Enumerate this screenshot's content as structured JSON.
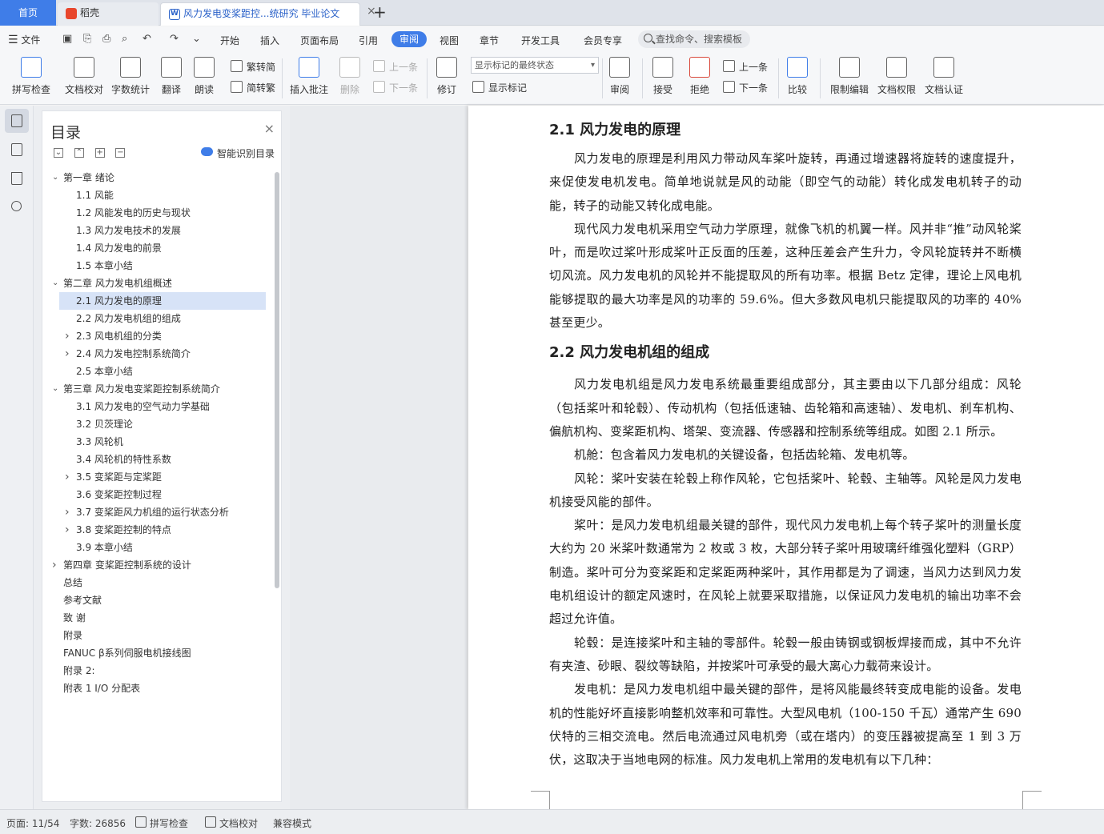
{
  "tabs": {
    "home": "首页",
    "daoke": "稻壳",
    "doc": "风力发电变桨距控...统研究 毕业论文",
    "close": "×",
    "add": "+"
  },
  "menu": {
    "file": "文件",
    "items": [
      "开始",
      "插入",
      "页面布局",
      "引用",
      "审阅",
      "视图",
      "章节",
      "开发工具",
      "会员专享"
    ],
    "active": "审阅",
    "search": "查找命令、搜索模板"
  },
  "ribbon": {
    "spell": "拼写检查",
    "proof": "文档校对",
    "count": "字数统计",
    "translate": "翻译",
    "read": "朗读",
    "trad": "繁转简",
    "simp": "简转繁",
    "insert_comment": "插入批注",
    "delete": "删除",
    "prev": "上一条",
    "next": "下一条",
    "revise": "修订",
    "markup_state": "显示标记的最终状态",
    "show_markup": "显示标记",
    "review": "审阅",
    "accept": "接受",
    "reject": "拒绝",
    "prev2": "上一条",
    "next2": "下一条",
    "compare": "比较",
    "restrict": "限制编辑",
    "rights": "文档权限",
    "certify": "文档认证"
  },
  "toc": {
    "title": "目录",
    "smart": "智能识别目录",
    "items": [
      {
        "label": "第一章  绪论",
        "level": 1,
        "arrow": "expanded"
      },
      {
        "label": "1.1 风能",
        "level": 2,
        "arrow": ""
      },
      {
        "label": "1.2 风能发电的历史与现状",
        "level": 2,
        "arrow": ""
      },
      {
        "label": "1.3 风力发电技术的发展",
        "level": 2,
        "arrow": ""
      },
      {
        "label": "1.4 风力发电的前景",
        "level": 2,
        "arrow": ""
      },
      {
        "label": "1.5  本章小结",
        "level": 2,
        "arrow": ""
      },
      {
        "label": "第二章  风力发电机组概述",
        "level": 1,
        "arrow": "expanded"
      },
      {
        "label": "2.1  风力发电的原理",
        "level": 2,
        "arrow": "",
        "active": true
      },
      {
        "label": "2.2  风力发电机组的组成",
        "level": 2,
        "arrow": ""
      },
      {
        "label": "2.3  风电机组的分类",
        "level": 2,
        "arrow": "collapsed"
      },
      {
        "label": "2.4  风力发电控制系统简介",
        "level": 2,
        "arrow": "collapsed"
      },
      {
        "label": "2.5  本章小结",
        "level": 2,
        "arrow": ""
      },
      {
        "label": "第三章  风力发电变桨距控制系统简介",
        "level": 1,
        "arrow": "expanded"
      },
      {
        "label": "3.1  风力发电的空气动力学基础",
        "level": 2,
        "arrow": ""
      },
      {
        "label": "3.2 贝茨理论",
        "level": 2,
        "arrow": ""
      },
      {
        "label": "3.3  风轮机",
        "level": 2,
        "arrow": ""
      },
      {
        "label": "3.4  风轮机的特性系数",
        "level": 2,
        "arrow": ""
      },
      {
        "label": "3.5 变桨距与定桨距",
        "level": 2,
        "arrow": "collapsed"
      },
      {
        "label": "3.6  变桨距控制过程",
        "level": 2,
        "arrow": ""
      },
      {
        "label": "3.7  变桨距风力机组的运行状态分析",
        "level": 2,
        "arrow": "collapsed"
      },
      {
        "label": "3.8  变桨距控制的特点",
        "level": 2,
        "arrow": "collapsed"
      },
      {
        "label": "3.9  本章小结",
        "level": 2,
        "arrow": ""
      },
      {
        "label": "第四章  变桨距控制系统的设计",
        "level": 1,
        "arrow": "collapsed"
      },
      {
        "label": "总结",
        "level": 1,
        "arrow": ""
      },
      {
        "label": "参考文献",
        "level": 1,
        "arrow": ""
      },
      {
        "label": "致    谢",
        "level": 1,
        "arrow": ""
      },
      {
        "label": "附录",
        "level": 1,
        "arrow": ""
      },
      {
        "label": "FANUC β系列伺服电机接线图",
        "level": 1,
        "arrow": ""
      },
      {
        "label": "附录 2:",
        "level": 1,
        "arrow": ""
      },
      {
        "label": "附表 1    I/O 分配表",
        "level": 1,
        "arrow": ""
      }
    ]
  },
  "doc": {
    "h1": "2.1  风力发电的原理",
    "p1": "风力发电的原理是利用风力带动风车桨叶旋转，再通过增速器将旋转的速度提升，来促使发电机发电。简单地说就是风的动能（即空气的动能）转化成发电机转子的动能，转子的动能又转化成电能。",
    "p2": "现代风力发电机采用空气动力学原理，就像飞机的机翼一样。风并非“推”动风轮桨叶，而是吹过桨叶形成桨叶正反面的压差，这种压差会产生升力，令风轮旋转并不断横切风流。风力发电机的风轮并不能提取风的所有功率。根据 Betz 定律，理论上风电机能够提取的最大功率是风的功率的 59.6%。但大多数风电机只能提取风的功率的 40%甚至更少。",
    "h2": "2.2  风力发电机组的组成",
    "p3": "风力发电机组是风力发电系统最重要组成部分，其主要由以下几部分组成：风轮（包括桨叶和轮毂）、传动机构（包括低速轴、齿轮箱和高速轴）、发电机、刹车机构、偏航机构、变桨距机构、塔架、变流器、传感器和控制系统等组成。如图 2.1 所示。",
    "p4": "机舱：包含着风力发电机的关键设备，包括齿轮箱、发电机等。",
    "p5": "风轮：桨叶安装在轮毂上称作风轮，它包括桨叶、轮毂、主轴等。风轮是风力发电机接受风能的部件。",
    "p6": "桨叶：是风力发电机组最关键的部件，现代风力发电机上每个转子桨叶的测量长度大约为 20 米桨叶数通常为 2 枚或 3 枚，大部分转子桨叶用玻璃纤维强化塑料（GRP）制造。桨叶可分为变桨距和定桨距两种桨叶，其作用都是为了调速，当风力达到风力发电机组设计的额定风速时，在风轮上就要采取措施，以保证风力发电机的输出功率不会超过允许值。",
    "p7": "轮毂：是连接桨叶和主轴的零部件。轮毂一般由铸钢或钢板焊接而成，其中不允许有夹渣、砂眼、裂纹等缺陷，并按桨叶可承受的最大离心力载荷来设计。",
    "p8": "发电机：是风力发电机组中最关键的部件，是将风能最终转变成电能的设备。发电机的性能好坏直接影响整机效率和可靠性。大型风电机（100-150 千瓦）通常产生 690 伏特的三相交流电。然后电流通过风电机旁（或在塔内）的变压器被提高至 1 到 3 万伏，这取决于当地电网的标准。风力发电机上常用的发电机有以下几种："
  },
  "status": {
    "page": "页面: 11/54",
    "words": "字数: 26856",
    "spell": "拼写检查",
    "proof": "文档校对",
    "compat": "兼容模式"
  }
}
